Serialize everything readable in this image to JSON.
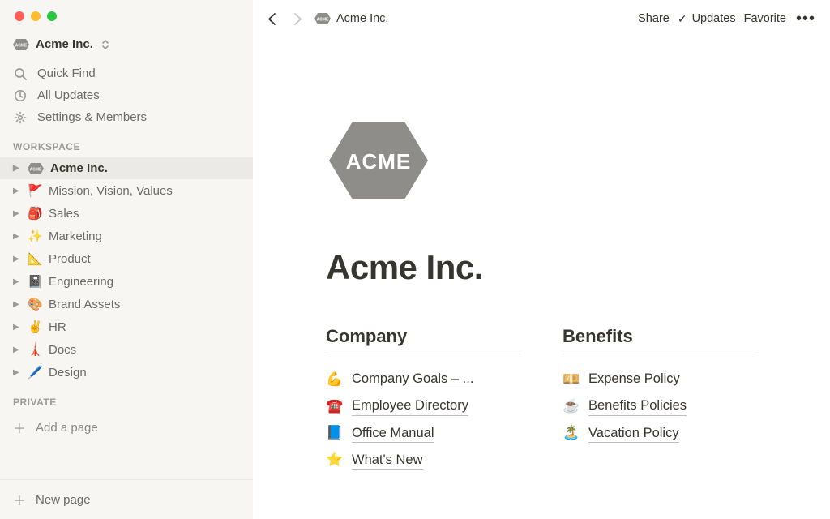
{
  "workspace_name": "Acme Inc.",
  "sidebar": {
    "quick_find": "Quick Find",
    "all_updates": "All Updates",
    "settings": "Settings & Members",
    "workspace_label": "WORKSPACE",
    "private_label": "PRIVATE",
    "add_page": "Add a page",
    "new_page": "New page",
    "pages": [
      {
        "emoji": "acme",
        "label": "Acme Inc.",
        "active": true
      },
      {
        "emoji": "🚩",
        "label": "Mission, Vision, Values"
      },
      {
        "emoji": "🎒",
        "label": "Sales"
      },
      {
        "emoji": "✨",
        "label": "Marketing"
      },
      {
        "emoji": "📐",
        "label": "Product"
      },
      {
        "emoji": "📓",
        "label": "Engineering"
      },
      {
        "emoji": "🎨",
        "label": "Brand Assets"
      },
      {
        "emoji": "✌️",
        "label": "HR"
      },
      {
        "emoji": "🗼",
        "label": "Docs"
      },
      {
        "emoji": "🖊️",
        "label": "Design"
      }
    ]
  },
  "topbar": {
    "breadcrumb": "Acme Inc.",
    "share": "Share",
    "updates": "Updates",
    "favorite": "Favorite"
  },
  "page": {
    "title": "Acme Inc.",
    "logo_text": "ACME",
    "columns": [
      {
        "heading": "Company",
        "links": [
          {
            "emoji": "💪",
            "label": "Company Goals – ..."
          },
          {
            "emoji": "☎️",
            "label": "Employee Directory"
          },
          {
            "emoji": "📘",
            "label": "Office Manual"
          },
          {
            "emoji": "⭐",
            "label": "What's New"
          }
        ]
      },
      {
        "heading": "Benefits",
        "links": [
          {
            "emoji": "💴",
            "label": "Expense Policy"
          },
          {
            "emoji": "☕",
            "label": "Benefits Policies"
          },
          {
            "emoji": "🏝️",
            "label": "Vacation Policy"
          }
        ]
      }
    ]
  }
}
